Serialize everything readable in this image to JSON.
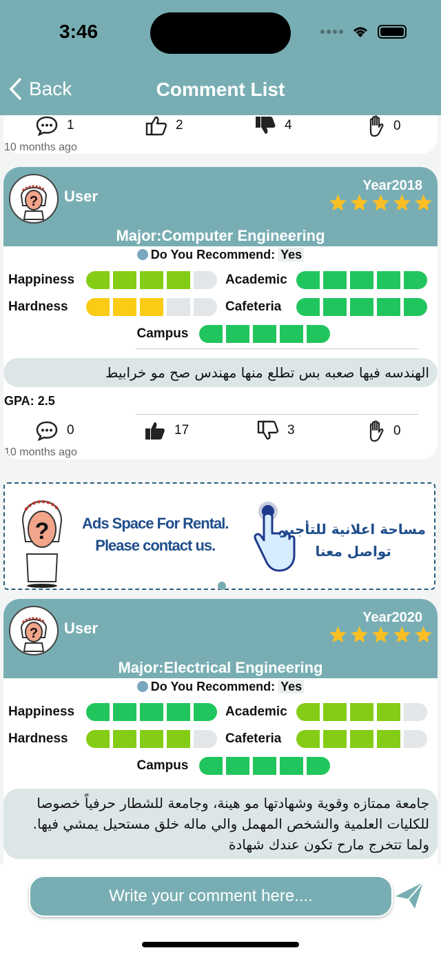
{
  "status": {
    "time": "3:46"
  },
  "header": {
    "back_label": "Back",
    "title": "Comment List"
  },
  "colors": {
    "header": "#78aeb3",
    "green": "#21c55d",
    "lime": "#84cc16",
    "yellow": "#facc15",
    "empty": "#e2e6e8",
    "star": "#fbbf24"
  },
  "prev_card": {
    "comments": "1",
    "likes": "2",
    "dislikes": "4",
    "raises": "0",
    "time_ago": "10 months ago"
  },
  "cards": [
    {
      "user": "User",
      "year": "Year2018",
      "rating_stars": 5,
      "major": "Major:Computer Engineering",
      "recommend_label": "Do You Recommend:",
      "recommend_value": "Yes",
      "happiness_label": "Happiness",
      "academic_label": "Academic",
      "hardness_label": "Hardness",
      "cafeteria_label": "Cafeteria",
      "campus_label": "Campus",
      "comment": "الهندسه فيها صعبه بس تطلع منها مهندس صح مو خرابيط",
      "gpa_label": "GPA:",
      "gpa_value": "2.5",
      "comments": "0",
      "likes": "17",
      "dislikes": "3",
      "raises": "0",
      "time_ago": "10 months ago"
    },
    {
      "user": "User",
      "year": "Year2020",
      "rating_stars": 5,
      "major": "Major:Electrical Engineering",
      "recommend_label": "Do You Recommend:",
      "recommend_value": "Yes",
      "happiness_label": "Happiness",
      "academic_label": "Academic",
      "hardness_label": "Hardness",
      "cafeteria_label": "Cafeteria",
      "campus_label": "Campus",
      "comment": "جامعة ممتازه وقوية وشهادتها مو هينة، وجامعة للشطار حرفياً خصوصا للكليات العلمية والشخص المهمل والي ماله خلق مستحيل يمشي فيها. ولما تتخرج مارح تكون عندك شهادة"
    }
  ],
  "ad": {
    "en_line1": "Ads Space For Rental.",
    "en_line2": "Please contact us.",
    "ar_line1": "مساحة اعلانية للتأجير",
    "ar_line2": "تواصل معنا"
  },
  "footer": {
    "placeholder": "Write your comment here...."
  }
}
